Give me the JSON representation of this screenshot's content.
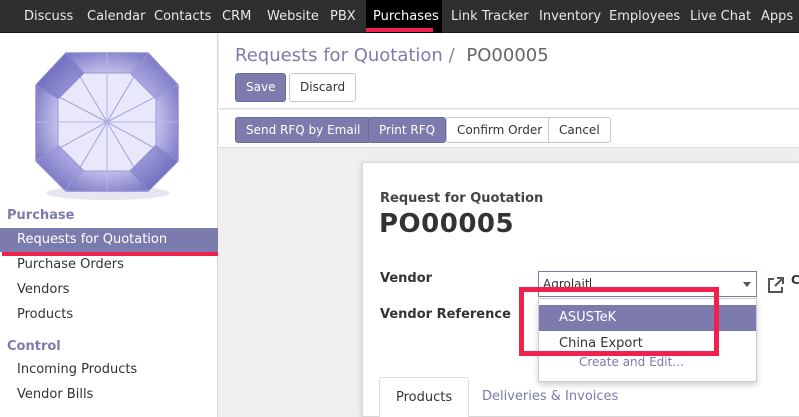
{
  "topnav": {
    "items": [
      "Discuss",
      "Calendar",
      "Contacts",
      "CRM",
      "Website",
      "PBX",
      "Purchases",
      "Link Tracker",
      "Inventory",
      "Employees",
      "Live Chat",
      "Apps"
    ],
    "active": "Purchases"
  },
  "sidebar": {
    "sections": [
      {
        "title": "Purchase",
        "items": [
          "Requests for Quotation",
          "Purchase Orders",
          "Vendors",
          "Products"
        ]
      },
      {
        "title": "Control",
        "items": [
          "Incoming Products",
          "Vendor Bills"
        ]
      }
    ],
    "active_item": "Requests for Quotation"
  },
  "breadcrumb": {
    "parent": "Requests for Quotation",
    "separator": "/",
    "current": "PO00005"
  },
  "buttons": {
    "save": "Save",
    "discard": "Discard",
    "send_rfq": "Send RFQ by Email",
    "print_rfq": "Print RFQ",
    "confirm_order": "Confirm Order",
    "cancel": "Cancel"
  },
  "form": {
    "subtitle": "Request for Quotation",
    "title": "PO00005",
    "vendor_label": "Vendor",
    "vendor_value": "Agrolait",
    "vendor_reference_label": "Vendor Reference",
    "open_label_fragment": "C",
    "dropdown": {
      "options": [
        "ASUSTeK",
        "China Export"
      ],
      "highlighted": "ASUSTeK",
      "create": "Create and Edit..."
    },
    "tabs": [
      "Products",
      "Deliveries & Invoices"
    ],
    "active_tab": "Products"
  },
  "colors": {
    "accent": "#7c7bad",
    "annotation": "#f0214e",
    "nav_bg": "#2f2f2f"
  }
}
